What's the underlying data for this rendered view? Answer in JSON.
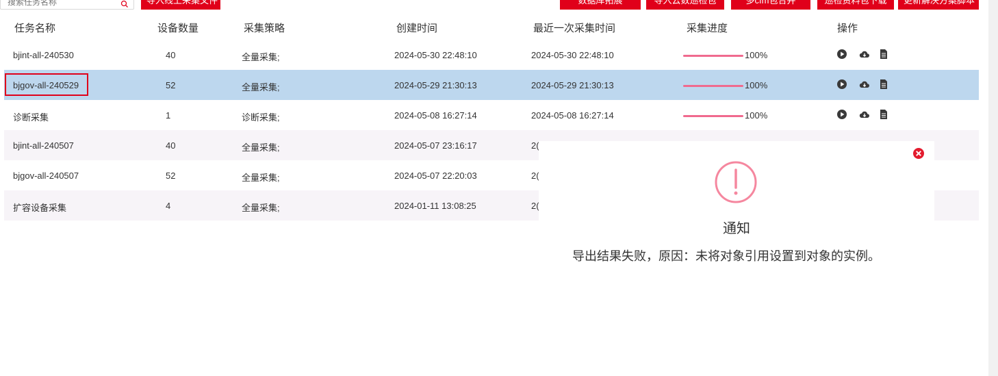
{
  "toolbar": {
    "search_placeholder": "搜索任务名称",
    "import_button": "导入线上采集文件",
    "buttons": [
      "数据库拓展",
      "导入云数巡检包",
      "多cfm包合并",
      "巡检资料包下载",
      "更新解决方案脚本"
    ]
  },
  "table": {
    "headers": [
      "任务名称",
      "设备数量",
      "采集策略",
      "创建时间",
      "最近一次采集时间",
      "采集进度",
      "操作"
    ],
    "rows": [
      {
        "name": "bjint-all-240530",
        "count": "40",
        "strategy": "全量采集;",
        "created": "2024-05-30 22:48:10",
        "last": "2024-05-30 22:48:10",
        "progress": "100%"
      },
      {
        "name": "bjgov-all-240529",
        "count": "52",
        "strategy": "全量采集;",
        "created": "2024-05-29 21:30:13",
        "last": "2024-05-29 21:30:13",
        "progress": "100%"
      },
      {
        "name": "诊断采集",
        "count": "1",
        "strategy": "诊断采集;",
        "created": "2024-05-08 16:27:14",
        "last": "2024-05-08 16:27:14",
        "progress": "100%"
      },
      {
        "name": "bjint-all-240507",
        "count": "40",
        "strategy": "全量采集;",
        "created": "2024-05-07 23:16:17",
        "last": "2(",
        "progress": ""
      },
      {
        "name": "bjgov-all-240507",
        "count": "52",
        "strategy": "全量采集;",
        "created": "2024-05-07 22:20:03",
        "last": "2(",
        "progress": ""
      },
      {
        "name": "扩容设备采集",
        "count": "4",
        "strategy": "全量采集;",
        "created": "2024-01-11 13:08:25",
        "last": "2(",
        "progress": ""
      }
    ],
    "selected_row": 1
  },
  "notification": {
    "title": "通知",
    "message": "导出结果失败，原因：未将对象引用设置到对象的实例。"
  },
  "colors": {
    "accent": "#e0001a",
    "selected_row": "#bdd7ee",
    "progress": "#f06a8e",
    "warning": "#f5879f"
  },
  "icons": [
    "search-icon",
    "play-icon",
    "cloud-download-icon",
    "document-icon",
    "close-icon",
    "warning-icon"
  ]
}
